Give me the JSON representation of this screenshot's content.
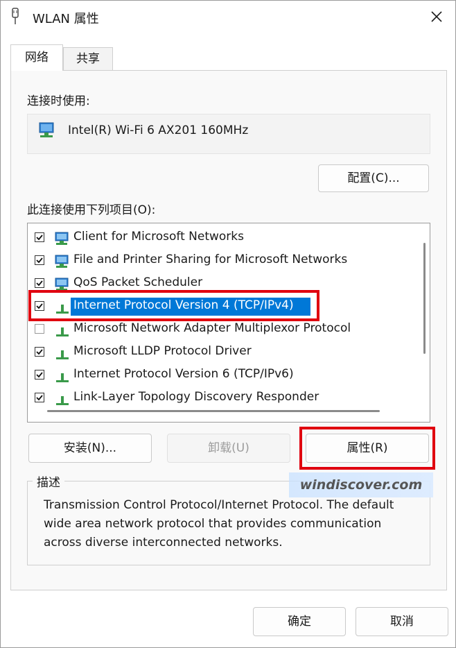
{
  "window": {
    "title": "WLAN 属性"
  },
  "tabs": [
    {
      "label": "网络",
      "active": true
    },
    {
      "label": "共享",
      "active": false
    }
  ],
  "connect_using": {
    "label": "连接时使用:",
    "adapter": "Intel(R) Wi-Fi 6 AX201 160MHz",
    "configure_label": "配置(C)..."
  },
  "items_section": {
    "label": "此连接使用下列项目(O):",
    "items": [
      {
        "label": "Client for Microsoft Networks",
        "checked": true,
        "icon": "network-client-icon"
      },
      {
        "label": "File and Printer Sharing for Microsoft Networks",
        "checked": true,
        "icon": "network-service-icon"
      },
      {
        "label": "QoS Packet Scheduler",
        "checked": true,
        "icon": "network-service-icon"
      },
      {
        "label": "Internet Protocol Version 4 (TCP/IPv4)",
        "checked": true,
        "selected": true,
        "icon": "protocol-icon"
      },
      {
        "label": "Microsoft Network Adapter Multiplexor Protocol",
        "checked": false,
        "icon": "protocol-icon"
      },
      {
        "label": "Microsoft LLDP Protocol Driver",
        "checked": true,
        "icon": "protocol-icon"
      },
      {
        "label": "Internet Protocol Version 6 (TCP/IPv6)",
        "checked": true,
        "icon": "protocol-icon"
      },
      {
        "label": "Link-Layer Topology Discovery Responder",
        "checked": true,
        "icon": "protocol-icon"
      }
    ]
  },
  "actions": {
    "install": "安装(N)...",
    "uninstall": "卸载(U)",
    "properties": "属性(R)"
  },
  "description": {
    "title": "描述",
    "text": "Transmission Control Protocol/Internet Protocol. The default wide area network protocol that provides communication across diverse interconnected networks."
  },
  "watermark": "windiscover.com",
  "footer": {
    "ok": "确定",
    "cancel": "取消"
  },
  "colors": {
    "selection": "#0078d7",
    "highlight_box": "#e0000f"
  }
}
